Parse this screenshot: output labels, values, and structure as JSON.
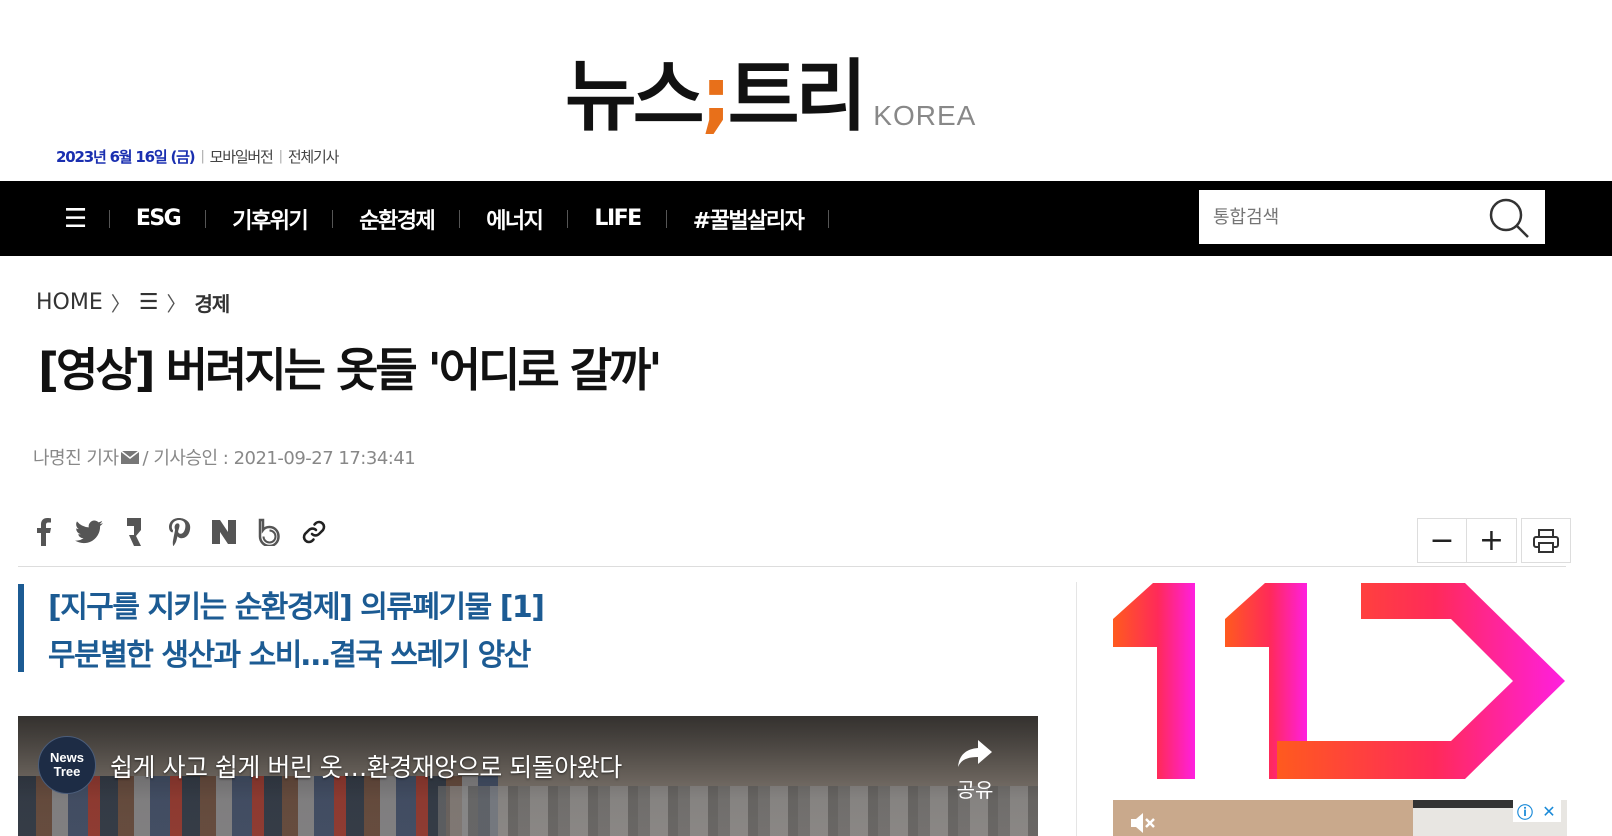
{
  "header": {
    "logo_main_1": "뉴스",
    "logo_semicolon": ";",
    "logo_main_2": "트리",
    "logo_sub": "KOREA",
    "date": "2023년 6월 16일 (금)",
    "mobile_link": "모바일버전",
    "all_articles_link": "전체기사"
  },
  "nav": {
    "menu_icon": "☰",
    "items": [
      "ESG",
      "기후위기",
      "순환경제",
      "에너지",
      "LIFE",
      "#꿀벌살리자"
    ],
    "search_placeholder": "통합검색"
  },
  "breadcrumb": {
    "home": "HOME",
    "middle": "☰",
    "current": "경제"
  },
  "article": {
    "title": "[영상] 버려지는 옷들 '어디로 갈까'",
    "reporter": "나명진 기자",
    "approved": "/ 기사승인 : 2021-09-27 17:34:41",
    "subtitle_line1": "[지구를 지키는 순환경제] 의류폐기물 [1]",
    "subtitle_line2": "무분별한 생산과 소비…결국 쓰레기 양산"
  },
  "share_icons": [
    "facebook-icon",
    "twitter-icon",
    "kakao-story-icon",
    "pinterest-icon",
    "naver-icon",
    "band-icon",
    "link-icon"
  ],
  "tools": {
    "font_decrease": "−",
    "font_increase": "+"
  },
  "video": {
    "channel_line1": "News",
    "channel_line2": "Tree",
    "title": "쉽게 사고 쉽게 버린 옷…환경재앙으로 되돌아왔다",
    "share_label": "공유"
  },
  "ad": {
    "brand_color_start": "#ff5a1e",
    "brand_color_end": "#ff1fe0",
    "info_badge": "ⓘ",
    "close_badge": "✕"
  }
}
